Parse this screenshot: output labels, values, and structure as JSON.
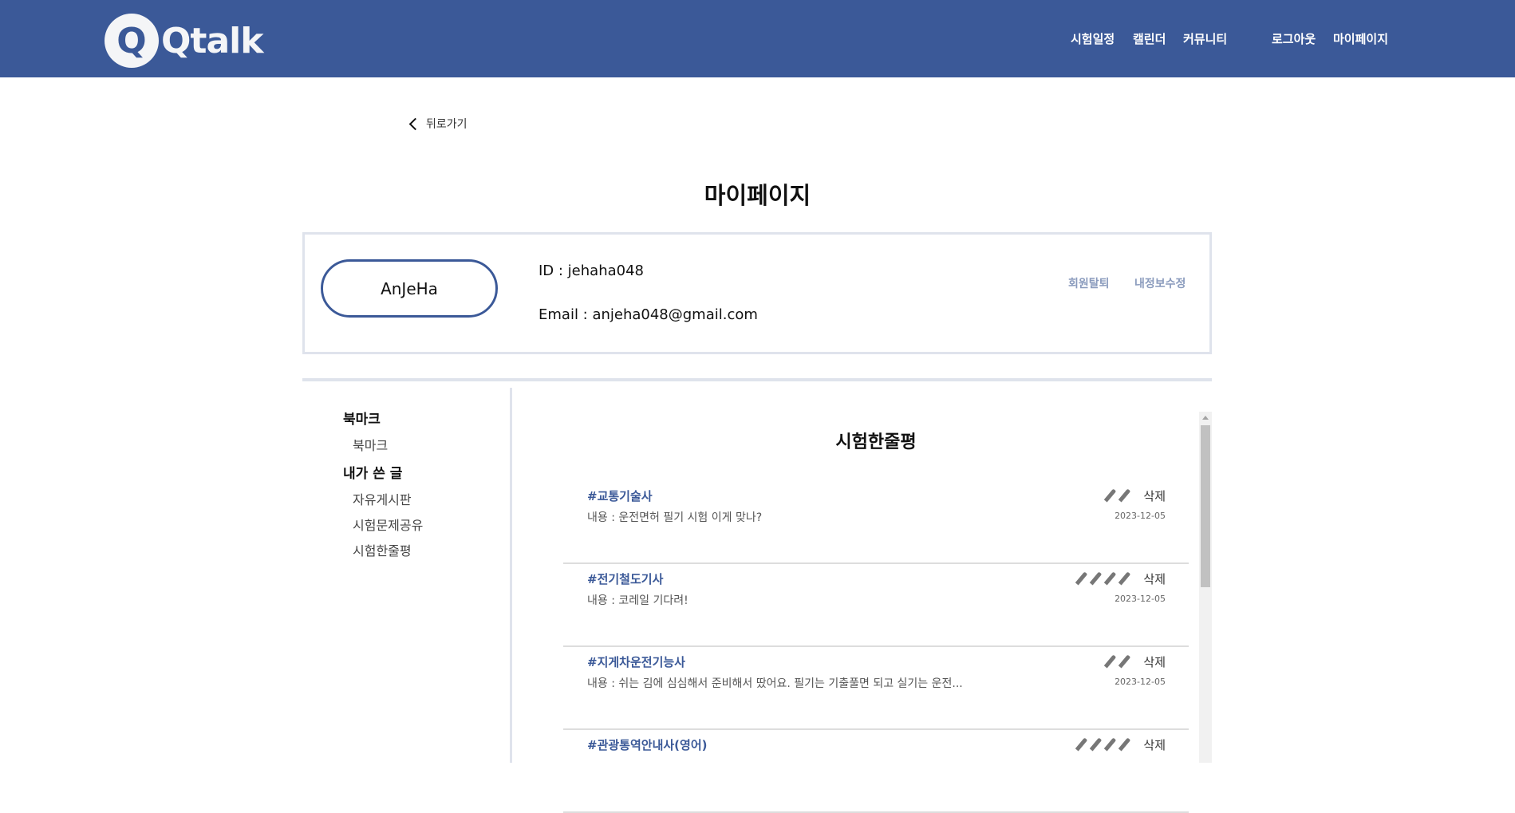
{
  "header": {
    "logo_text": "Qtalk",
    "logo_mark": "Q",
    "nav": [
      "시험일정",
      "캘린더",
      "커뮤니티"
    ],
    "logout": "로그아웃",
    "mypage": "마이페이지",
    "bg_color": "#3b5998"
  },
  "back_label": "뒤로가기",
  "page_title": "마이페이지",
  "profile": {
    "name": "AnJeHa",
    "id_line": "ID : jehaha048",
    "email_line": "Email : anjeha048@gmail.com",
    "withdraw": "회원탈퇴",
    "edit": "내정보수정"
  },
  "sidebar": {
    "bookmark_header": "북마크",
    "bookmark_item": "북마크",
    "my_posts_header": "내가 쓴 글",
    "my_posts": [
      "자유게시판",
      "시험문제공유",
      "시험한줄평"
    ]
  },
  "content": {
    "title": "시험한줄평",
    "delete_label": "삭제",
    "reviews": [
      {
        "tag": "#교통기술사",
        "text": "내용 : 운전면허 필기 시험 이게 맞나?",
        "date": "2023-12-05",
        "rating": 2
      },
      {
        "tag": "#전기철도기사",
        "text": "내용 : 코레일 기다려!",
        "date": "2023-12-05",
        "rating": 4
      },
      {
        "tag": "#지게차운전기능사",
        "text": "내용 : 쉬는 김에 심심해서 준비해서 땄어요. 필기는 기출풀면 되고 실기는 운전...",
        "date": "2023-12-05",
        "rating": 2
      },
      {
        "tag": "#관광통역안내사(영어)",
        "rating": 4
      }
    ]
  }
}
